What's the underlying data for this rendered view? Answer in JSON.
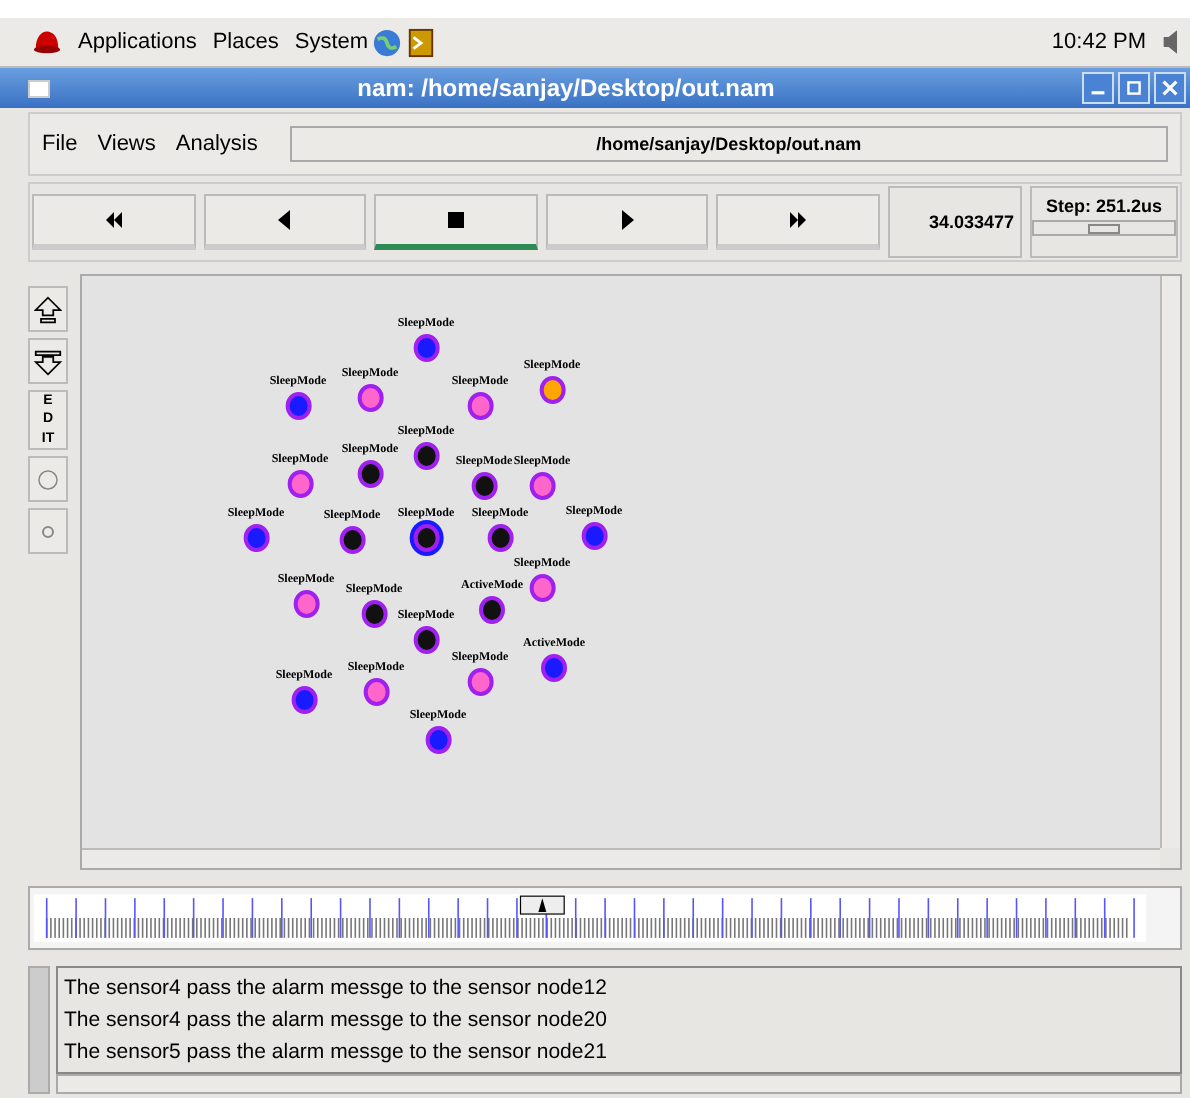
{
  "panel": {
    "menus": [
      "Applications",
      "Places",
      "System"
    ],
    "clock": "10:42 PM"
  },
  "window": {
    "title": "nam: /home/sanjay/Desktop/out.nam"
  },
  "menu": {
    "items": [
      "File",
      "Views",
      "Analysis"
    ],
    "path": "/home/sanjay/Desktop/out.nam"
  },
  "controls": {
    "buttons": [
      {
        "kind": "rewind",
        "selected": false
      },
      {
        "kind": "back",
        "selected": false
      },
      {
        "kind": "stop",
        "selected": true
      },
      {
        "kind": "play",
        "selected": false
      },
      {
        "kind": "forward",
        "selected": false
      }
    ],
    "time": "34.033477",
    "step": "Step: 251.2us",
    "step_slider": {
      "level": 0.5
    }
  },
  "side_tools": [
    {
      "kind": "zoom-in"
    },
    {
      "kind": "zoom-out"
    },
    {
      "kind": "edit",
      "label": "ED IT"
    },
    {
      "kind": "circle"
    },
    {
      "kind": "dot"
    }
  ],
  "nodes": [
    {
      "label": "SleepMode",
      "color": "#1a1aff",
      "highlighted": false
    },
    {
      "label": "SleepMode",
      "color": "#1a1aff",
      "highlighted": false
    },
    {
      "label": "SleepMode",
      "color": "#ff66cc",
      "highlighted": false
    },
    {
      "label": "SleepMode",
      "color": "#ff66cc",
      "highlighted": false
    },
    {
      "label": "SleepMode",
      "color": "#ffa500",
      "highlighted": false
    },
    {
      "label": "SleepMode",
      "color": "#111111",
      "highlighted": false
    },
    {
      "label": "SleepMode",
      "color": "#ff66cc",
      "highlighted": false
    },
    {
      "label": "SleepMode",
      "color": "#111111",
      "highlighted": false
    },
    {
      "label": "SleepMode",
      "color": "#111111",
      "highlighted": false
    },
    {
      "label": "SleepMode",
      "color": "#ff66cc",
      "highlighted": false
    },
    {
      "label": "SleepMode",
      "color": "#1a1aff",
      "highlighted": false
    },
    {
      "label": "SleepMode",
      "color": "#111111",
      "highlighted": false
    },
    {
      "label": "SleepMode",
      "color": "#111111",
      "highlighted": true
    },
    {
      "label": "SleepMode",
      "color": "#111111",
      "highlighted": false
    },
    {
      "label": "SleepMode",
      "color": "#1a1aff",
      "highlighted": false
    },
    {
      "label": "SleepMode",
      "color": "#ff66cc",
      "highlighted": false
    },
    {
      "label": "SleepMode",
      "color": "#111111",
      "highlighted": false
    },
    {
      "label": "SleepMode",
      "color": "#111111",
      "highlighted": false
    },
    {
      "label": "ActiveMode",
      "color": "#111111",
      "highlighted": false
    },
    {
      "label": "SleepMode",
      "color": "#ff66cc",
      "highlighted": false
    },
    {
      "label": "SleepMode",
      "color": "#1a1aff",
      "highlighted": false
    },
    {
      "label": "SleepMode",
      "color": "#ff66cc",
      "highlighted": false
    },
    {
      "label": "SleepMode",
      "color": "#ff66cc",
      "highlighted": false
    },
    {
      "label": "ActiveMode",
      "color": "#1a1aff",
      "highlighted": false
    },
    {
      "label": "SleepMode",
      "color": "#1a1aff",
      "highlighted": false
    }
  ],
  "messages": [
    "The sensor4 pass the alarm messge to the sensor node12",
    "The sensor4 pass the alarm messge to the sensor node20",
    "The sensor5 pass the alarm messge to the sensor node21"
  ]
}
